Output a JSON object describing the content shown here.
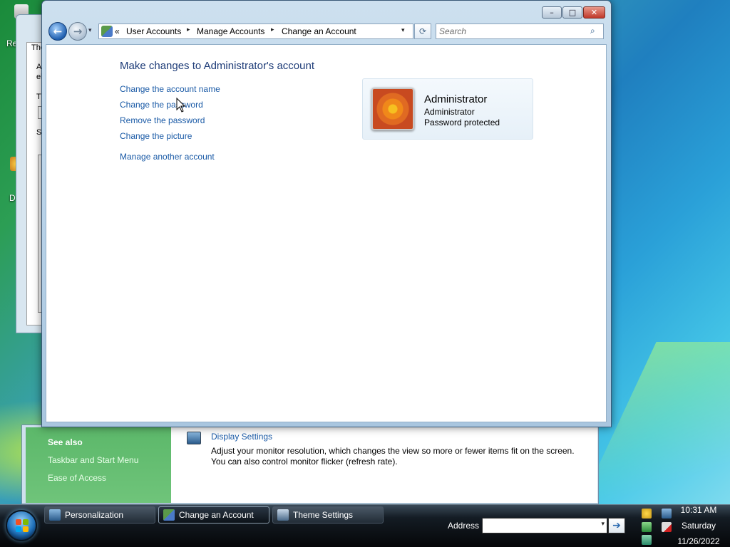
{
  "desktop": {
    "icon_labels": [
      "Re",
      "D"
    ]
  },
  "bg_window_left": {
    "title_fragment": "The",
    "texts": [
      "A",
      "el",
      "Th",
      "Sa"
    ]
  },
  "bg_window_personalization": {
    "see_also": {
      "title": "See also",
      "links": [
        "Taskbar and Start Menu",
        "Ease of Access"
      ]
    },
    "display_settings": {
      "link": "Display Settings",
      "desc_line1": "Adjust your monitor resolution, which changes the view so more or fewer items fit on the screen.",
      "desc_line2": "You can also control monitor flicker (refresh rate)."
    }
  },
  "window": {
    "caption_buttons": {
      "minimize": "–",
      "maximize": "□",
      "close": "✕"
    },
    "nav": {
      "back_glyph": "←",
      "forward_glyph": "→",
      "history_glyph": "▾"
    },
    "address": {
      "overflow": "«",
      "crumbs": [
        "User Accounts",
        "Manage Accounts",
        "Change an Account"
      ],
      "separator": "▸",
      "dropdown_glyph": "▾",
      "refresh_glyph": "⟳"
    },
    "search": {
      "placeholder": "Search",
      "icon_glyph": "⌕"
    },
    "heading": "Make changes to Administrator's account",
    "tasks": [
      "Change the account name",
      "Change the password",
      "Remove the password",
      "Change the picture",
      "Manage another account"
    ],
    "user": {
      "name": "Administrator",
      "type": "Administrator",
      "status": "Password protected"
    }
  },
  "taskbar": {
    "buttons": [
      {
        "label": "Personalization",
        "icon": "personalization-icon",
        "active": false
      },
      {
        "label": "Change an Account",
        "icon": "user-accounts-icon",
        "active": true
      },
      {
        "label": "Theme Settings",
        "icon": "theme-icon",
        "active": false
      }
    ],
    "address_label": "Address",
    "address_value": "",
    "go_glyph": "➔",
    "clock": {
      "time": "10:31 AM",
      "day": "Saturday",
      "date": "11/26/2022"
    }
  },
  "colors": {
    "link": "#1a5aa6",
    "heading": "#1e3c78",
    "close_button": "#c0392b"
  }
}
